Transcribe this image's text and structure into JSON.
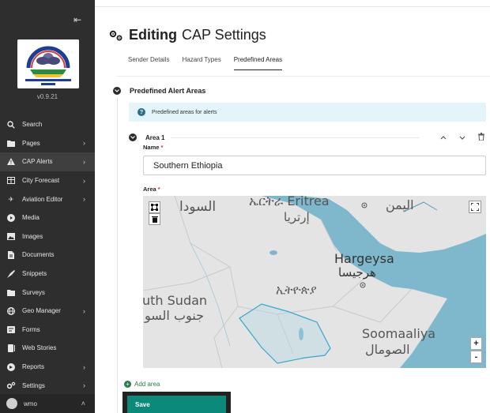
{
  "sidebar": {
    "collapse_icon": "collapse-arrow-icon",
    "version": "v0.9.21",
    "logo_text": "Ethiopian Meteorology Institute",
    "items": [
      {
        "label": "Search",
        "icon": "search-icon",
        "has_children": false
      },
      {
        "label": "Pages",
        "icon": "folder-icon",
        "has_children": true
      },
      {
        "label": "CAP Alerts",
        "icon": "warning-icon",
        "has_children": true
      },
      {
        "label": "City Forecast",
        "icon": "table-icon",
        "has_children": true
      },
      {
        "label": "Aviation Editor",
        "icon": "plane-icon",
        "has_children": true
      },
      {
        "label": "Media",
        "icon": "play-icon",
        "has_children": false
      },
      {
        "label": "Images",
        "icon": "image-icon",
        "has_children": false
      },
      {
        "label": "Documents",
        "icon": "document-icon",
        "has_children": false
      },
      {
        "label": "Snippets",
        "icon": "snippet-icon",
        "has_children": false
      },
      {
        "label": "Surveys",
        "icon": "folder-icon",
        "has_children": false
      },
      {
        "label": "Geo Manager",
        "icon": "globe-icon",
        "has_children": true
      },
      {
        "label": "Forms",
        "icon": "forms-icon",
        "has_children": false
      },
      {
        "label": "Web Stories",
        "icon": "stories-icon",
        "has_children": false
      },
      {
        "label": "Reports",
        "icon": "reports-icon",
        "has_children": true
      },
      {
        "label": "Settings",
        "icon": "gear-icon",
        "has_children": true
      }
    ],
    "user": {
      "name": "wmo"
    }
  },
  "header": {
    "title_bold": "Editing",
    "title_rest": "CAP Settings"
  },
  "tabs": [
    {
      "label": "Sender Details",
      "active": false
    },
    {
      "label": "Hazard Types",
      "active": false
    },
    {
      "label": "Predefined Areas",
      "active": true
    }
  ],
  "section": {
    "title": "Predefined Alert Areas",
    "help_text": "Predefined areas for alerts"
  },
  "area": {
    "label": "Area 1",
    "name_label": "Name",
    "name_value": "Southern Ethiopia",
    "area_label": "Area",
    "required_mark": "*"
  },
  "map": {
    "labels": [
      {
        "text": "السودا"
      },
      {
        "text": "ኤርትራ Eritrea"
      },
      {
        "text": "إرتريا"
      },
      {
        "text": "اليمن"
      },
      {
        "text": "Hargeysa"
      },
      {
        "text": "هرجيسا"
      },
      {
        "text": "ኢትዮጵያ"
      },
      {
        "text": "uth Sudan"
      },
      {
        "text": "جنوب السو"
      },
      {
        "text": "Soomaaliya"
      },
      {
        "text": "الصومال"
      }
    ],
    "zoom_in": "+",
    "zoom_out": "-",
    "colors": {
      "land": "#e4e4e4",
      "water": "#7fb7cd",
      "polygon_stroke": "#3aa6c9"
    }
  },
  "actions": {
    "add_area": "Add area",
    "save": "Save"
  },
  "colors": {
    "sidebar_bg": "#2e2e2e",
    "accent": "#0b8a7a",
    "info_bg": "#e3f4fb"
  }
}
